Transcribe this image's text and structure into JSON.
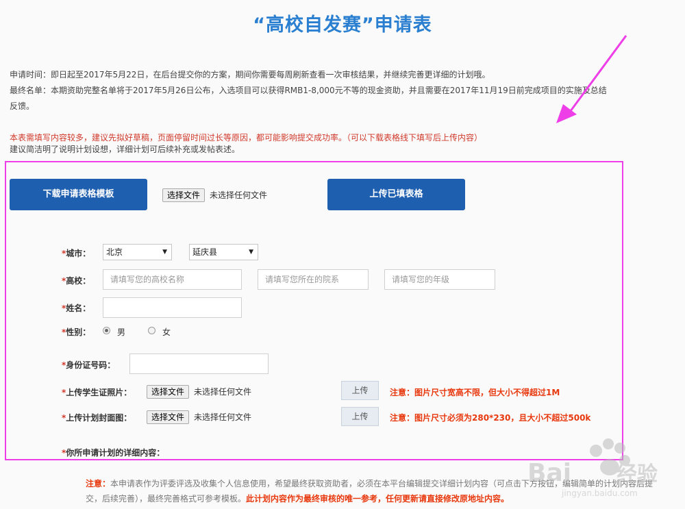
{
  "page": {
    "title": "“高校自发赛”申请表",
    "intro": [
      "申请时间：即日起至2017年5月22日，在后台提交你的方案，期间你需要每周刷新查看一次审核结果，并继续完善更详细的计划哦。",
      "最终名单：本期资助完整名单将于2017年5月26日公布，入选项目可以获得RMB1-8,000元不等的现金资助，并且需要在2017年11月19日前完成项目的实施及总结",
      "反馈。"
    ],
    "warning_red": "本表需填写内容较多，建议先拟好草稿，页面停留时间过长等原因，都可能影响提交成功率。（可以下载表格线下填写后上传内容）",
    "warning_dark": "建议简洁明了说明计划设想，详细计划可后续补充或发帖表述。"
  },
  "top_actions": {
    "download_label": "下载申请表格模板",
    "choose_file_label": "选择文件",
    "no_file_label": "未选择任何文件",
    "upload_filled_label": "上传已填表格"
  },
  "form": {
    "required_mark": "*",
    "city": {
      "label": "城市：",
      "province": "北京",
      "county": "延庆县"
    },
    "school": {
      "label": "高校：",
      "name_placeholder": "请填写您的高校名称",
      "dept_placeholder": "请填写您所在的院系",
      "grade_placeholder": "请填写您的年级"
    },
    "name": {
      "label": "姓名："
    },
    "gender": {
      "label": "性别：",
      "options": [
        "男",
        "女"
      ],
      "selected": "男"
    },
    "id_number": {
      "label": "身份证号码："
    },
    "student_card": {
      "label": "上传学生证照片：",
      "choose_label": "选择文件",
      "no_file_label": "未选择任何文件",
      "upload_label": "上传",
      "note": "注意：图片尺寸宽高不限，但大小不得超过1M"
    },
    "cover": {
      "label": "上传计划封面图：",
      "choose_label": "选择文件",
      "no_file_label": "未选择任何文件",
      "upload_label": "上传",
      "note": "注意：图片尺寸必须为280*230，且大小不超过500k"
    },
    "detail": {
      "label": "你所申请计划的详细内容："
    }
  },
  "bottom": {
    "note_prefix": "注意：",
    "note_body": "本申请表作为评委评选及收集个人信息使用，希望最终获取资助者，必须在本平台编辑提交详细计划内容（可点击下方按钮，编辑简单的计划内容后提交，后续完善），最终完善格式可参考模板。",
    "note_emphasis": "此计划内容作为最终审核的唯一参考，任何更新请直接修改原地址内容。"
  },
  "watermark": {
    "text": "Bai 经验",
    "sub": "jingyan.baidu.com"
  },
  "colors": {
    "accent": "#1f5fb0",
    "title": "#2a7fd0",
    "required": "#d0392b",
    "note": "#e8380d",
    "highlight": "#ee3ee8"
  }
}
